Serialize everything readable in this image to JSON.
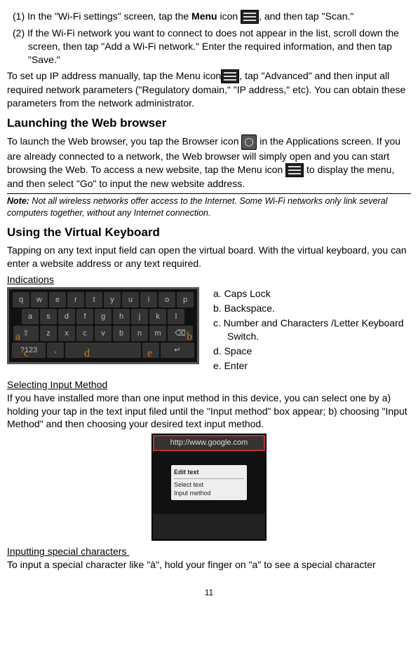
{
  "step1_prefix": "(1) ",
  "step1_a": "In the \"Wi-Fi settings\" screen, tap the ",
  "step1_menu_bold": "Menu",
  "step1_b": " icon ",
  "step1_c": ", and then tap \"Scan.\"",
  "step2_prefix": "(2) ",
  "step2": "If the Wi-Fi network you want to connect to does not appear in the list, scroll down the screen, then tap \"Add a Wi-Fi network.\" Enter the required information, and then tap \"Save.\"",
  "ip_a": "To set up IP address manually, tap the Menu icon",
  "ip_b": ", tap \"Advanced\" and then input all required network parameters (\"Regulatory domain,\" \"IP address,\" etc). You can obtain these parameters from the network administrator.",
  "h_launch": "Launching the Web browser",
  "launch_a": "To launch the Web browser, you tap the Browser icon ",
  "launch_b": " in the Applications screen. If you are already connected to a network, the Web browser will simply open and you can start browsing the Web. To access a new website, tap the Menu icon ",
  "launch_c": " to display the menu, and then select \"Go\" to input the new website address.",
  "note_label": "Note:",
  "note_text": " Not all wireless networks offer access to the Internet. Some Wi-Fi networks only link several computers together, without any Internet connection.",
  "h_vk": "Using the Virtual Keyboard",
  "vk_intro": "Tapping on any text input field can open the virtual board. With the virtual keyboard, you can enter a website address or any text required.",
  "indications": "Indications",
  "lbl_a": "a",
  "lbl_b": "b",
  "lbl_c": "c",
  "lbl_d": "d",
  "lbl_e": "e",
  "legend": {
    "a": "a.  Caps Lock",
    "b": "b.  Backspace.",
    "c": "c.  Number and Characters /Letter Keyboard Switch.",
    "d": "d.  Space",
    "e": "e.  Enter"
  },
  "h_select": "Selecting Input Method",
  "select_text": "If you have installed more than one input method in this device, you can select one by a) holding your tap in the text input filed until the \"Input method\" box appear; b) choosing \"Input Method\" and then choosing your desired text input method.",
  "popup_header": "http://www.google.com",
  "popup_title": "Edit text",
  "popup_opt1": "Select text",
  "popup_opt2": "Input method",
  "h_special": "Inputting special characters",
  "special_text": "To input a special character like \"à\", hold your finger on \"a\" to see a special character",
  "page_num": "11",
  "keys_r1": [
    "q",
    "w",
    "e",
    "r",
    "t",
    "y",
    "u",
    "i",
    "o",
    "p"
  ],
  "keys_r2": [
    "a",
    "s",
    "d",
    "f",
    "g",
    "h",
    "j",
    "k",
    "l"
  ],
  "keys_r3_mid": [
    "z",
    "x",
    "c",
    "v",
    "b",
    "n",
    "m"
  ]
}
